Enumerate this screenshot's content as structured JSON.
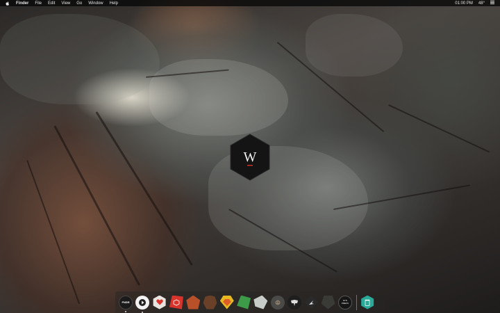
{
  "menubar": {
    "app_name": "Finder",
    "items": [
      "File",
      "Edit",
      "View",
      "Go",
      "Window",
      "Help"
    ],
    "time": "01:00 PM",
    "temperature": "48°"
  },
  "logo": {
    "letter": "W"
  },
  "dock": {
    "items": [
      {
        "name": "fndr",
        "label": "FNDR",
        "bg": "#1a1a1a",
        "running": true
      },
      {
        "name": "itunes",
        "label": "",
        "bg": "#f2f2f2",
        "running": true
      },
      {
        "name": "heart-app",
        "label": "",
        "bg": "#e8e4e0",
        "running": true
      },
      {
        "name": "red-cube-app",
        "label": "",
        "bg": "#d8342c",
        "running": true
      },
      {
        "name": "lion-app",
        "label": "",
        "bg": "#b8502a",
        "running": false
      },
      {
        "name": "bear-app",
        "label": "",
        "bg": "#6a4028",
        "running": false
      },
      {
        "name": "sketch-app",
        "label": "",
        "bg": "#e8b820",
        "running": false
      },
      {
        "name": "lizard-app",
        "label": "",
        "bg": "#3c9a48",
        "running": false
      },
      {
        "name": "bird-app",
        "label": "",
        "bg": "#c8ccc8",
        "running": false
      },
      {
        "name": "monkey-app",
        "label": "",
        "bg": "#4a4a48",
        "running": false
      },
      {
        "name": "elephant-app",
        "label": "",
        "bg": "#1e1e1e",
        "running": false
      },
      {
        "name": "eagle-app",
        "label": "",
        "bg": "#2a2a2a",
        "running": false
      },
      {
        "name": "dark-animal-app",
        "label": "",
        "bg": "#3a3a36",
        "running": false
      },
      {
        "name": "system-prefs",
        "label": "SYS PREFS",
        "bg": "#151515",
        "running": false
      },
      {
        "name": "trash",
        "label": "",
        "bg": "#2aa898",
        "running": false
      }
    ]
  },
  "colors": {
    "menubar_bg": "#0a0a0a",
    "logo_bg": "#141414",
    "logo_accent": "#d8342c"
  }
}
